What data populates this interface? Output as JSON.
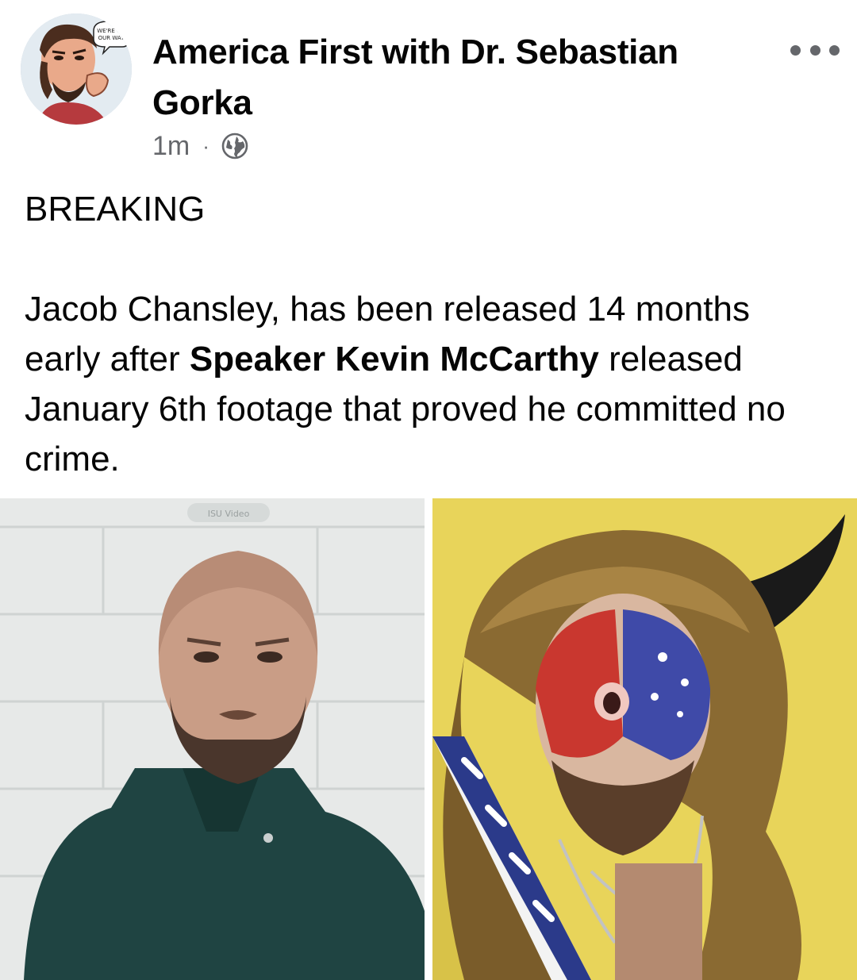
{
  "post": {
    "author": "America First with Dr. Sebastian Gorka",
    "timestamp": "1m",
    "separator": "·",
    "audience_icon": "globe-icon",
    "more_icon": "more-options-icon",
    "headline": "BREAKING",
    "body": {
      "part1": "Jacob Chansley, has been released 14 months early after ",
      "bold": "Speaker Kevin McCarthy",
      "part2": " released January 6th footage that proved he committed no crime."
    },
    "avatar_caption": "WE'RE ON OUR WAY"
  },
  "photos": [
    {
      "name": "photo-video-call",
      "watermark": "ISU Video"
    },
    {
      "name": "photo-face-paint-fur-hat"
    }
  ],
  "colors": {
    "text": "#050505",
    "secondary": "#65676b",
    "background": "#ffffff"
  }
}
